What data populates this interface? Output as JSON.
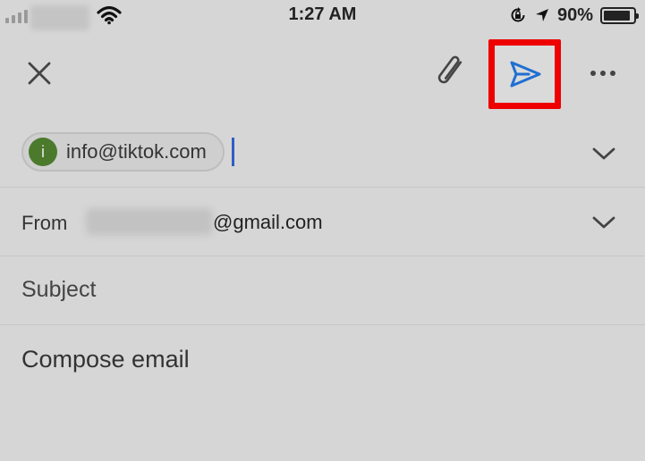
{
  "status_bar": {
    "time": "1:27 AM",
    "battery_percent": "90%",
    "battery_level": 0.9
  },
  "toolbar": {
    "close_icon": "close-icon",
    "attach_icon": "paperclip-icon",
    "send_icon": "send-icon",
    "more_icon": "more-horizontal-icon",
    "highlight_color": "#ee0000",
    "send_color": "#1f6fd1"
  },
  "recipients": {
    "chips": [
      {
        "avatar_letter": "i",
        "address": "info@tiktok.com",
        "avatar_color": "#4b7a2d"
      }
    ]
  },
  "from": {
    "label": "From",
    "value": "@gmail.com"
  },
  "subject": {
    "placeholder": "Subject"
  },
  "compose": {
    "placeholder": "Compose email"
  }
}
